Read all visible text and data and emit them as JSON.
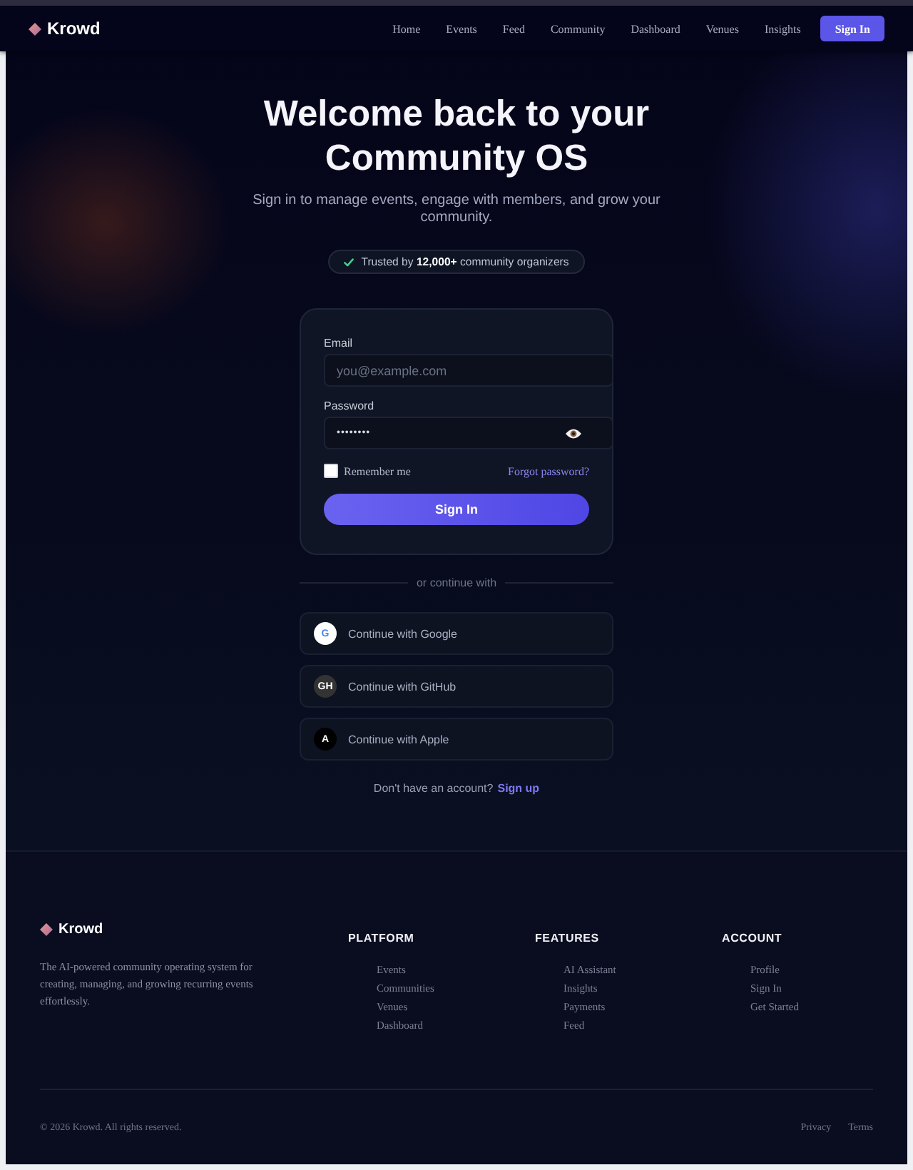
{
  "nav": {
    "brand": "Krowd",
    "links": [
      "Home",
      "Events",
      "Feed",
      "Community",
      "Dashboard",
      "Venues",
      "Insights"
    ],
    "cta": "Sign In"
  },
  "hero": {
    "title": "Welcome back to your Community OS",
    "subtitle": "Sign in to manage events, engage with members, and grow your community.",
    "badge": "Trusted by **12,000+** community organizers"
  },
  "form": {
    "fields": [
      {
        "kind": "email",
        "label": "Email",
        "placeholder": "you@example.com"
      },
      {
        "kind": "password",
        "label": "Password",
        "value": "••••••••"
      }
    ],
    "remember": {
      "label": "Remember me",
      "checked": false
    },
    "forgot": "Forgot password?",
    "submit": "Sign In"
  },
  "divider": "or continue with",
  "social": [
    {
      "kind": "google",
      "monogram": "G",
      "label": "Continue with Google"
    },
    {
      "kind": "github",
      "monogram": "GH",
      "label": "Continue with GitHub"
    },
    {
      "kind": "apple",
      "monogram": "A",
      "label": "Continue with Apple"
    }
  ],
  "signup": {
    "prompt": "Don't have an account?",
    "link": "Sign up"
  },
  "footer": {
    "brand": "Krowd",
    "description": "The AI-powered community operating system for creating, managing, and growing recurring events effortlessly.",
    "columns": [
      {
        "heading": "PLATFORM",
        "links": [
          "Events",
          "Communities",
          "Venues",
          "Dashboard"
        ]
      },
      {
        "heading": "FEATURES",
        "links": [
          "AI Assistant",
          "Insights",
          "Payments",
          "Feed"
        ]
      },
      {
        "heading": "ACCOUNT",
        "links": [
          "Profile",
          "Sign In",
          "Get Started"
        ]
      }
    ],
    "copyright": "© 2026 Krowd. All rights reserved.",
    "legal": [
      "Privacy",
      "Terms"
    ]
  }
}
